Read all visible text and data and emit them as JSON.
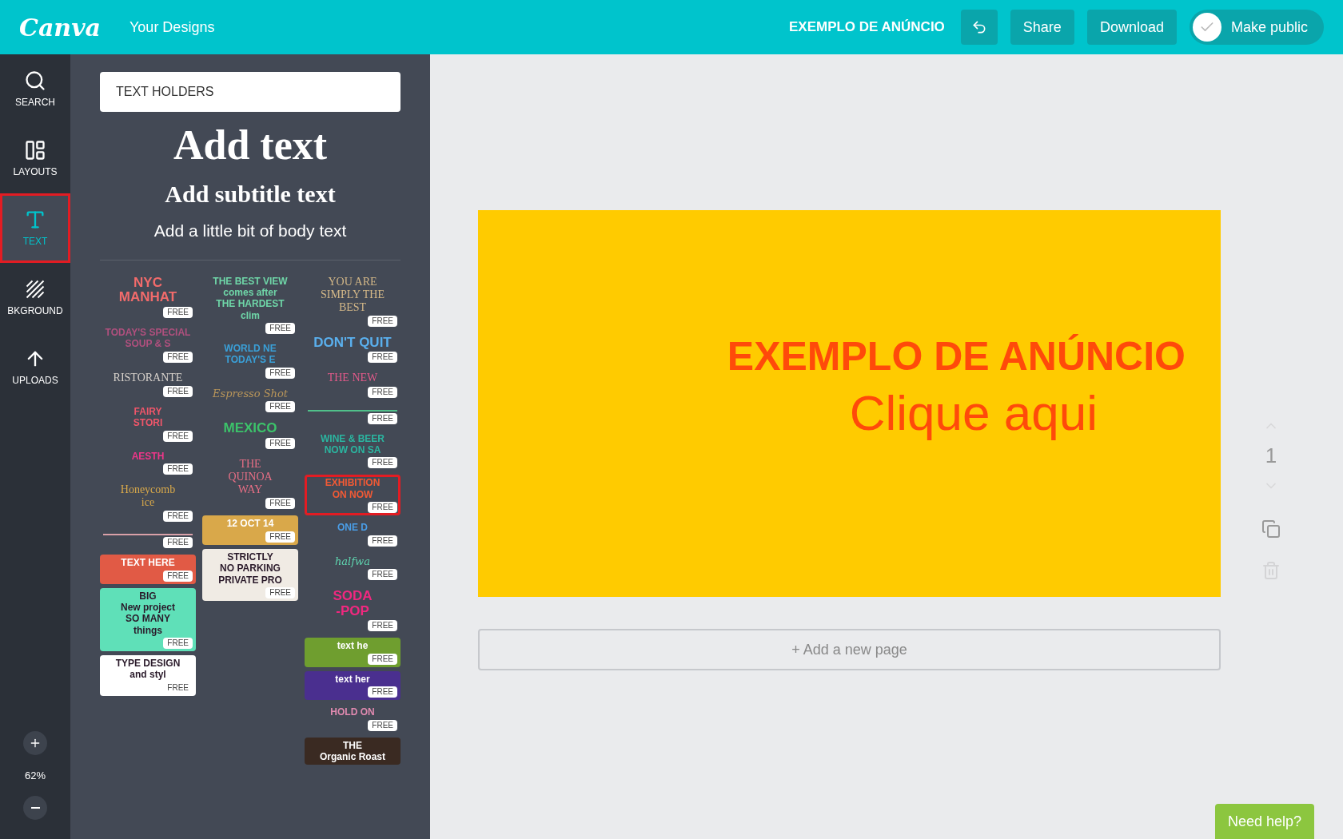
{
  "topbar": {
    "logo": "Canva",
    "nav_link": "Your Designs",
    "design_title": "EXEMPLO DE ANÚNCIO",
    "buttons": [
      "Share",
      "Download"
    ],
    "make_public": {
      "label": "Make public",
      "on": true
    }
  },
  "sidebar": {
    "items": [
      {
        "label": "SEARCH",
        "selected": false
      },
      {
        "label": "LAYOUTS",
        "selected": false
      },
      {
        "label": "TEXT",
        "selected": true
      },
      {
        "label": "BKGROUND",
        "selected": false
      },
      {
        "label": "UPLOADS",
        "selected": false
      }
    ],
    "zoom": "62%"
  },
  "panel": {
    "search": {
      "value": "TEXT HOLDERS"
    },
    "add_heading": "Add text",
    "add_subtitle": "Add subtitle text",
    "add_body": "Add a little bit of body text",
    "columns": [
      [
        {
          "kind": "block",
          "color": "#f26b6b",
          "lines": [
            "NYC",
            "MANHAT"
          ],
          "badge": "FREE",
          "selected": false
        },
        {
          "kind": "plain",
          "color": "#b0507e",
          "lines": [
            "TODAY'S SPECIAL",
            "SOUP & S"
          ],
          "badge": "FREE",
          "selected": false
        },
        {
          "kind": "serif",
          "color": "#d8d2cc",
          "lines": [
            "RISTORANTE"
          ],
          "badge": "FREE",
          "selected": false
        },
        {
          "kind": "plain",
          "color": "#f0566a",
          "lines": [
            "FAIRY",
            "STORI"
          ],
          "badge": "FREE",
          "selected": false
        },
        {
          "kind": "plain",
          "color": "#f0368a",
          "lines": [
            "AESTH"
          ],
          "badge": "FREE",
          "selected": false
        },
        {
          "kind": "serif",
          "color": "#d9a94a",
          "lines": [
            "Honeycomb",
            "ice"
          ],
          "badge": "FREE",
          "selected": false
        },
        {
          "kind": "plain",
          "color": "#d9a0a8",
          "badge": "FREE",
          "selected": false
        },
        {
          "kind": "filled",
          "color": "#e15a45",
          "lines": [
            "TEXT HERE"
          ],
          "badge": "FREE",
          "selected": false
        },
        {
          "kind": "sign",
          "color": "#5fe0b8",
          "lines": [
            "BIG",
            "New project",
            "SO MANY",
            "things"
          ],
          "badge": "FREE",
          "selected": false
        },
        {
          "kind": "sign",
          "color": "#ffffff",
          "lines": [
            "TYPE DESIGN",
            "and styl"
          ],
          "badge": "FREE",
          "selected": false
        }
      ],
      [
        {
          "kind": "plain",
          "color": "#6fd6a8",
          "lines": [
            "THE BEST VIEW",
            "comes after",
            "THE HARDEST",
            "clim"
          ],
          "badge": "FREE",
          "selected": false
        },
        {
          "kind": "plain",
          "color": "#3aa0d8",
          "lines": [
            "WORLD NE",
            "TODAY'S E"
          ],
          "badge": "FREE",
          "selected": false
        },
        {
          "kind": "script",
          "color": "#b8955a",
          "lines": [
            "Espresso Shot"
          ],
          "badge": "FREE",
          "selected": false
        },
        {
          "kind": "block",
          "color": "#3cc36a",
          "lines": [
            "MEXICO"
          ],
          "badge": "FREE",
          "selected": false
        },
        {
          "kind": "serif",
          "color": "#e86f85",
          "lines": [
            "THE",
            "QUINOA",
            "WAY"
          ],
          "badge": "FREE",
          "selected": false
        },
        {
          "kind": "filled",
          "color": "#d9a84a",
          "lines": [
            "12 OCT 14"
          ],
          "badge": "FREE",
          "selected": false
        },
        {
          "kind": "sign",
          "color": "#f0ebe4",
          "lines": [
            "STRICTLY",
            "NO PARKING",
            "PRIVATE PRO"
          ],
          "badge": "FREE",
          "selected": false
        }
      ],
      [
        {
          "kind": "serif",
          "color": "#d4b888",
          "lines": [
            "YOU ARE SIMPLY THE",
            "BEST"
          ],
          "badge": "FREE",
          "selected": false
        },
        {
          "kind": "block",
          "color": "#5ab0ee",
          "lines": [
            "DON'T QUIT"
          ],
          "badge": "FREE",
          "selected": false
        },
        {
          "kind": "serif",
          "color": "#e25a8a",
          "lines": [
            "THE NEW"
          ],
          "badge": "FREE",
          "selected": false
        },
        {
          "kind": "plain",
          "color": "#50c08a",
          "badge": "FREE",
          "selected": false
        },
        {
          "kind": "plain",
          "color": "#2bb5a0",
          "lines": [
            "WINE & BEER",
            "NOW ON SA"
          ],
          "badge": "FREE",
          "selected": false
        },
        {
          "kind": "plain",
          "color": "#f25a35",
          "lines": [
            "EXHIBITION",
            "ON NOW"
          ],
          "badge": "FREE",
          "selected": true
        },
        {
          "kind": "plain",
          "color": "#4a9ee8",
          "lines": [
            "ONE D"
          ],
          "badge": "FREE",
          "selected": false
        },
        {
          "kind": "script",
          "color": "#5fd6b0",
          "lines": [
            "halfwa"
          ],
          "badge": "FREE",
          "selected": false
        },
        {
          "kind": "block",
          "color": "#f0287f",
          "lines": [
            "SODA",
            "-POP"
          ],
          "badge": "FREE",
          "selected": false
        },
        {
          "kind": "filled",
          "color": "#6f9e2f",
          "lines": [
            "text he"
          ],
          "badge": "FREE",
          "selected": false
        },
        {
          "kind": "filled",
          "color": "#4a2f8f",
          "lines": [
            "text her"
          ],
          "badge": "FREE",
          "selected": false
        },
        {
          "kind": "plain",
          "color": "#e08ab0",
          "lines": [
            "HOLD ON"
          ],
          "badge": "FREE",
          "selected": false
        },
        {
          "kind": "filled",
          "color": "#3a2a22",
          "lines": [
            "THE",
            "Organic Roast"
          ],
          "selected": false
        }
      ]
    ]
  },
  "canvas": {
    "headline": "EXEMPLO DE ANÚNCIO",
    "subline": "Clique aqui",
    "add_page": "+ Add a new page",
    "page_number": "1"
  },
  "help_button": "Need help?"
}
